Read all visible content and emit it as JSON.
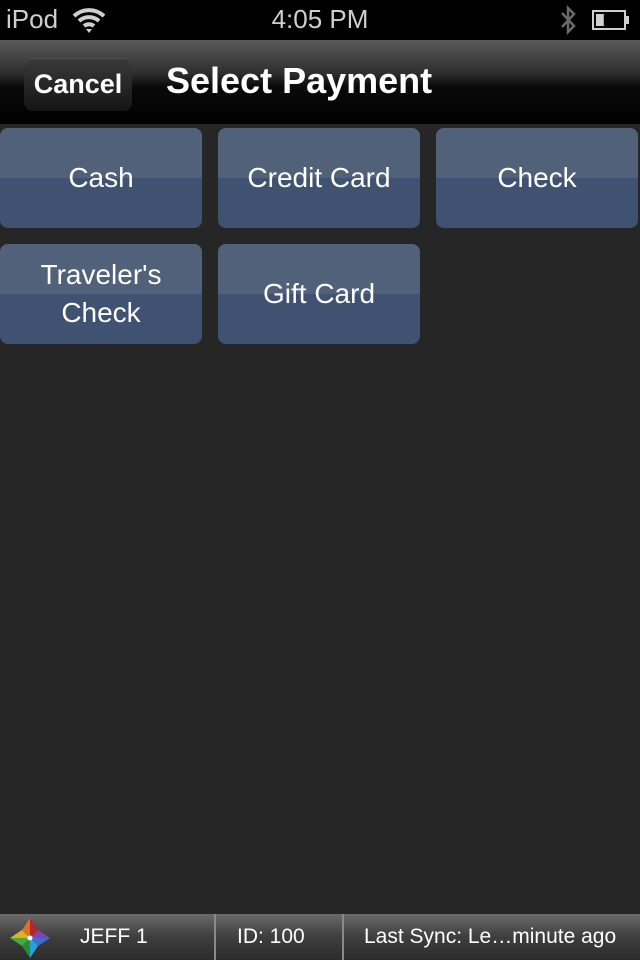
{
  "status_bar": {
    "carrier": "iPod",
    "time": "4:05 PM",
    "icons": [
      "wifi-icon",
      "bluetooth-icon",
      "battery-icon"
    ],
    "battery_level": 0.3
  },
  "nav_bar": {
    "cancel_label": "Cancel",
    "title": "Select Payment"
  },
  "payment_options": [
    {
      "label": "Cash"
    },
    {
      "label": "Credit Card"
    },
    {
      "label": "Check"
    },
    {
      "label": "Traveler's\nCheck"
    },
    {
      "label": "Gift Card"
    }
  ],
  "colors": {
    "button_bg": "#3f5272",
    "button_highlight": "#52617a",
    "page_bg": "#262626"
  },
  "bottom_bar": {
    "logo": "app-logo-icon",
    "user": "JEFF 1",
    "id": "ID: 100",
    "sync": "Last Sync: Le…minute ago"
  }
}
